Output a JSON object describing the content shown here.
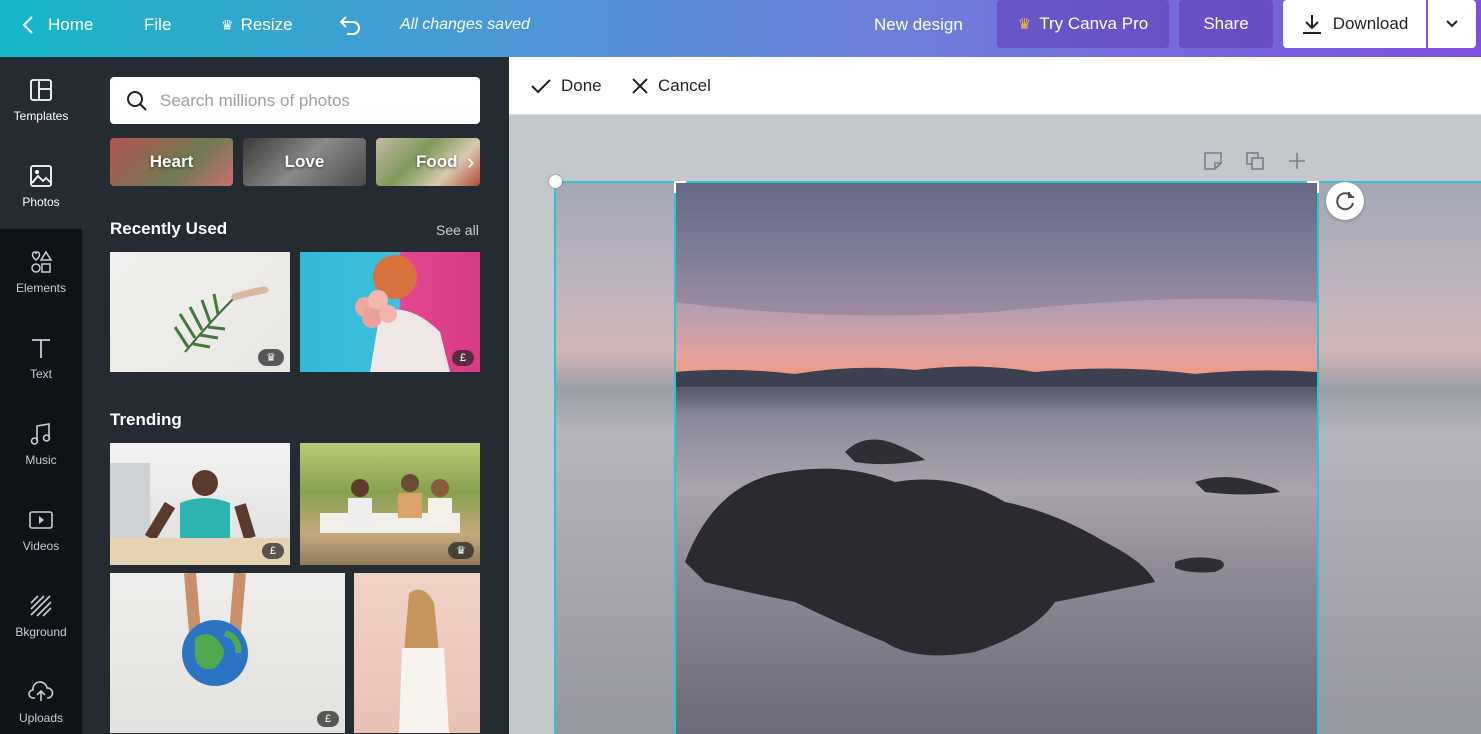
{
  "topbar": {
    "home_label": "Home",
    "file_label": "File",
    "resize_label": "Resize",
    "saved_status": "All changes saved",
    "new_design_label": "New design",
    "try_pro_label": "Try Canva Pro",
    "share_label": "Share",
    "download_label": "Download"
  },
  "rail": {
    "items": [
      {
        "label": "Templates",
        "icon": "templates-icon"
      },
      {
        "label": "Photos",
        "icon": "photos-icon"
      },
      {
        "label": "Elements",
        "icon": "elements-icon"
      },
      {
        "label": "Text",
        "icon": "text-icon"
      },
      {
        "label": "Music",
        "icon": "music-icon"
      },
      {
        "label": "Videos",
        "icon": "videos-icon"
      },
      {
        "label": "Bkground",
        "icon": "background-icon"
      },
      {
        "label": "Uploads",
        "icon": "uploads-icon"
      }
    ]
  },
  "panel": {
    "search_placeholder": "Search millions of photos",
    "chips": [
      "Heart",
      "Love",
      "Food"
    ],
    "recently_used_title": "Recently Used",
    "see_all": "See all",
    "trending_title": "Trending",
    "badges": {
      "pro": "♛",
      "paid": "£"
    }
  },
  "crop_bar": {
    "done_label": "Done",
    "cancel_label": "Cancel"
  },
  "colors": {
    "accent_cyan": "#2fc5d0",
    "rail_bg": "#0e1318",
    "panel_bg": "#252b33"
  }
}
